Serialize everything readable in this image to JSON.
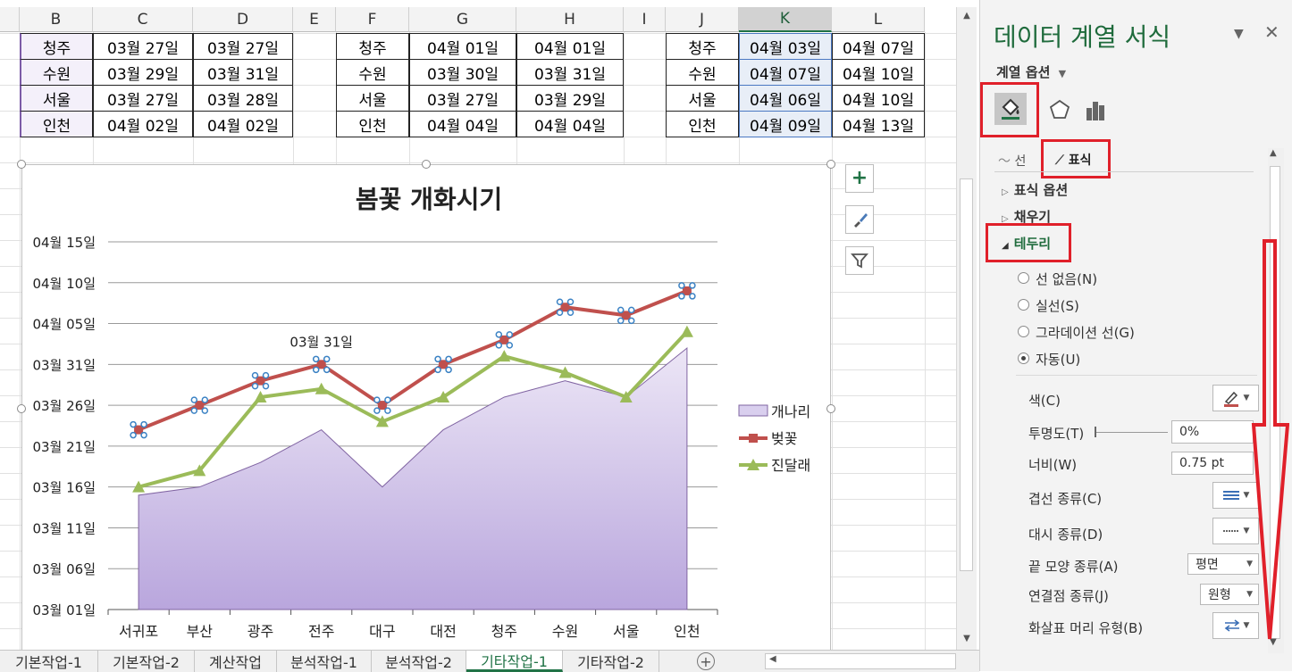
{
  "sheet": {
    "columns": [
      "B",
      "C",
      "D",
      "E",
      "F",
      "G",
      "H",
      "I",
      "J",
      "K",
      "L"
    ],
    "tables": [
      {
        "rows": [
          [
            "청주",
            "03월 27일",
            "03월 27일"
          ],
          [
            "수원",
            "03월 29일",
            "03월 31일"
          ],
          [
            "서울",
            "03월 27일",
            "03월 28일"
          ],
          [
            "인천",
            "04월 02일",
            "04월 02일"
          ]
        ]
      },
      {
        "rows": [
          [
            "청주",
            "04월 01일",
            "04월 01일"
          ],
          [
            "수원",
            "03월 30일",
            "03월 31일"
          ],
          [
            "서울",
            "03월 27일",
            "03월 29일"
          ],
          [
            "인천",
            "04월 04일",
            "04월 04일"
          ]
        ]
      },
      {
        "rows": [
          [
            "청주",
            "04월 03일",
            "04월 07일"
          ],
          [
            "수원",
            "04월 07일",
            "04월 10일"
          ],
          [
            "서울",
            "04월 06일",
            "04월 10일"
          ],
          [
            "인천",
            "04월 09일",
            "04월 13일"
          ]
        ]
      }
    ]
  },
  "chart_data": {
    "type": "line",
    "title": "봄꽃 개화시기",
    "categories": [
      "서귀포",
      "부산",
      "광주",
      "전주",
      "대구",
      "대전",
      "청주",
      "수원",
      "서울",
      "인천"
    ],
    "y_tick_labels": [
      "04월 15일",
      "04월 10일",
      "04월 05일",
      "03월 31일",
      "03월 26일",
      "03월 21일",
      "03월 16일",
      "03월 11일",
      "03월 06일",
      "03월 01일"
    ],
    "y_axis": {
      "min": "03-01",
      "max": "04-15",
      "step_days": 5
    },
    "series": [
      {
        "name": "개나리",
        "kind": "area",
        "color": "#b9a6dd",
        "values": [
          "03-15",
          "03-16",
          "03-19",
          "03-23",
          "03-16",
          "03-23",
          "03-27",
          "03-29",
          "03-27",
          "04-02"
        ]
      },
      {
        "name": "벚꽃",
        "kind": "line",
        "marker": "square",
        "color": "#c0504d",
        "values": [
          "03-23",
          "03-26",
          "03-29",
          "03-31",
          "03-26",
          "03-31",
          "04-03",
          "04-07",
          "04-06",
          "04-09"
        ]
      },
      {
        "name": "진달래",
        "kind": "line",
        "marker": "triangle",
        "color": "#9bbb59",
        "values": [
          "03-16",
          "03-18",
          "03-27",
          "03-28",
          "03-24",
          "03-27",
          "04-01",
          "03-30",
          "03-27",
          "04-04"
        ]
      }
    ],
    "data_label": "03월 31일",
    "legend": "right",
    "grid": true
  },
  "chart_ui": {
    "plus": "+",
    "brush": "brush-icon",
    "filter": "filter-icon"
  },
  "tabs": [
    "기본작업-1",
    "기본작업-2",
    "계산작업",
    "분석작업-1",
    "분석작업-2",
    "기타작업-1",
    "기타작업-2"
  ],
  "active_tab": "기타작업-1",
  "pane": {
    "title": "데이터 계열 서식",
    "series_options": "계열 옵션",
    "subtab_line": "선",
    "subtab_marker": "표식",
    "sections": [
      "표식 옵션",
      "채우기",
      "테두리"
    ],
    "border_options": [
      "선 없음(N)",
      "실선(S)",
      "그라데이션 선(G)",
      "자동(U)"
    ],
    "selected_option": "자동(U)",
    "labels": {
      "color": "색(C)",
      "transparency": "투명도(T)",
      "width": "너비(W)",
      "compound": "겹선 종류(C)",
      "dash": "대시 종류(D)",
      "cap": "끝 모양 종류(A)",
      "join": "연결점 종류(J)",
      "arrow": "화살표 머리 유형(B)"
    },
    "values": {
      "transparency": "0%",
      "width": "0.75 pt",
      "cap": "평면",
      "join": "원형"
    },
    "close": "✕"
  }
}
